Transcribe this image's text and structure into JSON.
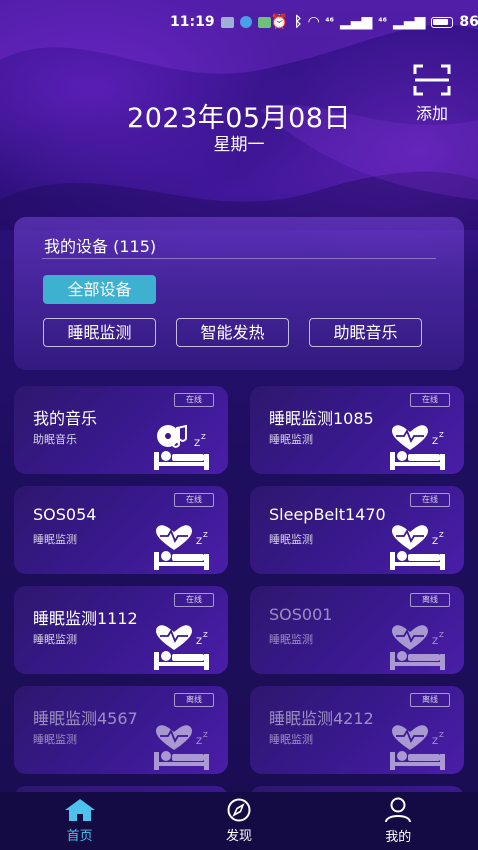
{
  "status_bar": {
    "time": "11:19",
    "net1": "⁴⁶",
    "net2": "⁴⁶",
    "battery": "86%",
    "battery_level": 0.86
  },
  "header": {
    "date": "2023年05月08日",
    "weekday": "星期一",
    "add_label": "添加"
  },
  "devices_panel": {
    "title": "我的设备 (115)",
    "all_label": "全部设备",
    "types": [
      "睡眠监测",
      "智能发热",
      "助眠音乐"
    ]
  },
  "devices": [
    {
      "name": "我的音乐",
      "type": "助眠音乐",
      "status": "在线",
      "online": true,
      "icon": "music-sleep-icon"
    },
    {
      "name": "睡眠监测1085",
      "type": "睡眠监测",
      "status": "在线",
      "online": true,
      "icon": "heart-sleep-icon"
    },
    {
      "name": "SOS054",
      "type": "睡眠监测",
      "status": "在线",
      "online": true,
      "icon": "heart-sleep-icon"
    },
    {
      "name": "SleepBelt1470",
      "type": "睡眠监测",
      "status": "在线",
      "online": true,
      "icon": "heart-sleep-icon"
    },
    {
      "name": "睡眠监测1112",
      "type": "睡眠监测",
      "status": "在线",
      "online": true,
      "icon": "heart-sleep-icon"
    },
    {
      "name": "SOS001",
      "type": "睡眠监测",
      "status": "离线",
      "online": false,
      "icon": "heart-sleep-icon"
    },
    {
      "name": "睡眠监测4567",
      "type": "睡眠监测",
      "status": "离线",
      "online": false,
      "icon": "heart-sleep-icon"
    },
    {
      "name": "睡眠监测4212",
      "type": "睡眠监测",
      "status": "离线",
      "online": false,
      "icon": "heart-sleep-icon"
    }
  ],
  "nav": {
    "home": "首页",
    "discover": "发现",
    "mine": "我的",
    "active_color": "#4cc2ec"
  },
  "colors": {
    "accent": "#3fb1d0",
    "background": "#1d0f57"
  }
}
